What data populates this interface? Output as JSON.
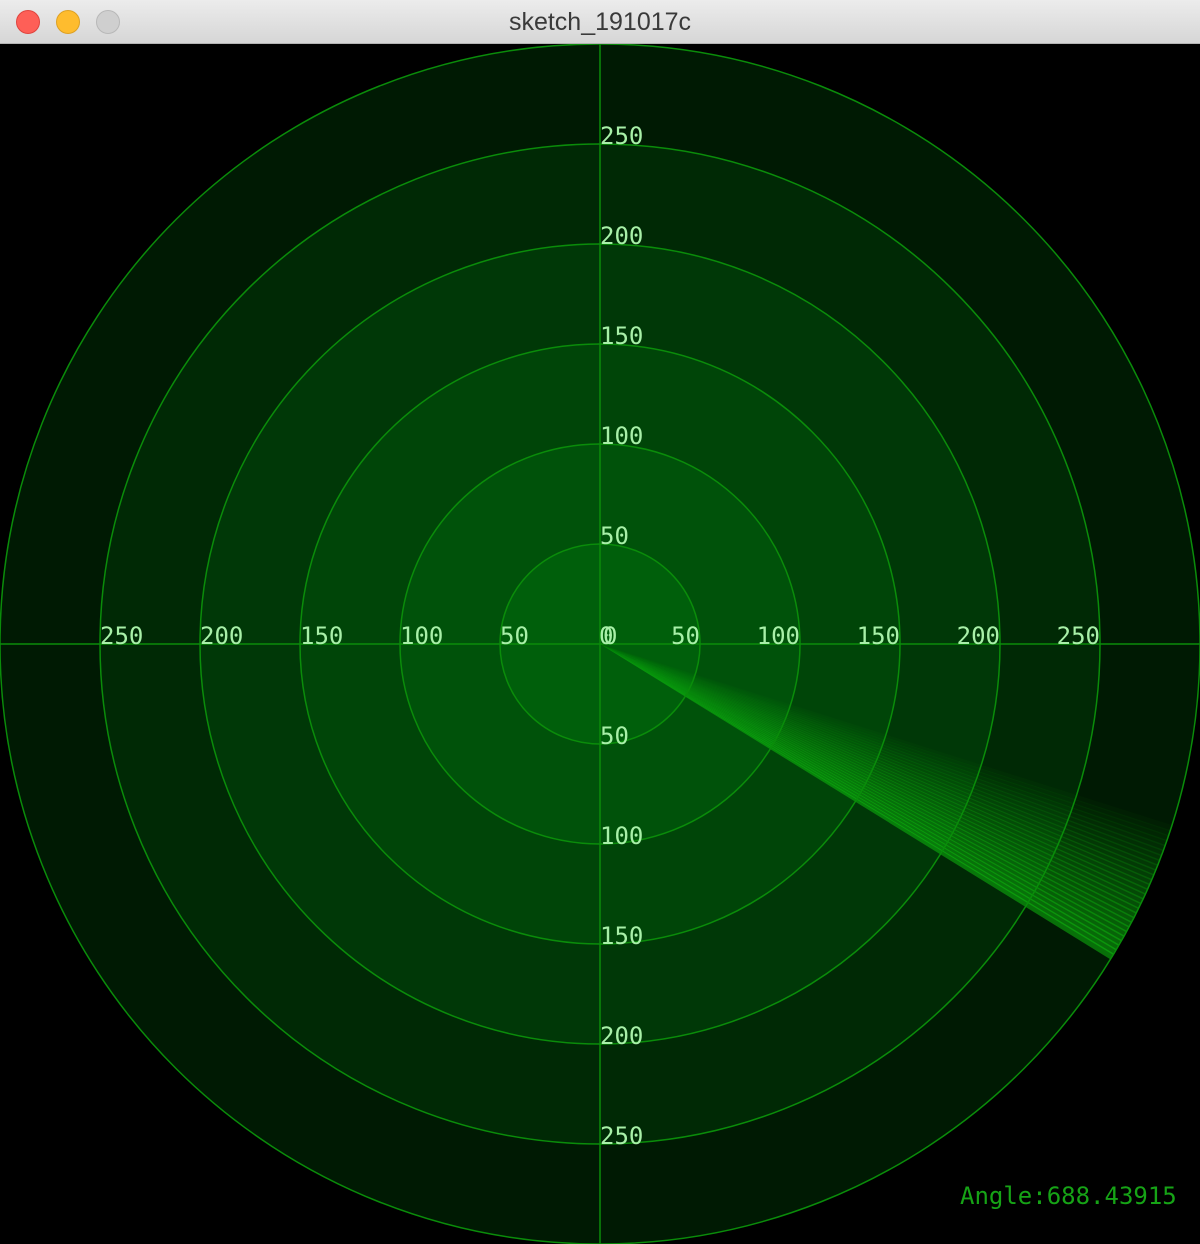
{
  "window": {
    "title": "sketch_191017c",
    "buttons": [
      "close",
      "minimize",
      "zoom"
    ]
  },
  "colors": {
    "background": "#000000",
    "grid_line": "#0a8c0a",
    "label": "#a8f0a8",
    "sweep": "#0fbf0f",
    "angle_text": "#16a316"
  },
  "radar": {
    "rings": [
      50,
      100,
      150,
      200,
      250,
      300
    ],
    "ring_labels": [
      "50",
      "100",
      "150",
      "200",
      "250"
    ],
    "center_label": "0",
    "angle_label": "Angle:688.43915",
    "sweep_angle_deg": 688.43915,
    "sweep_span_deg": 14
  }
}
